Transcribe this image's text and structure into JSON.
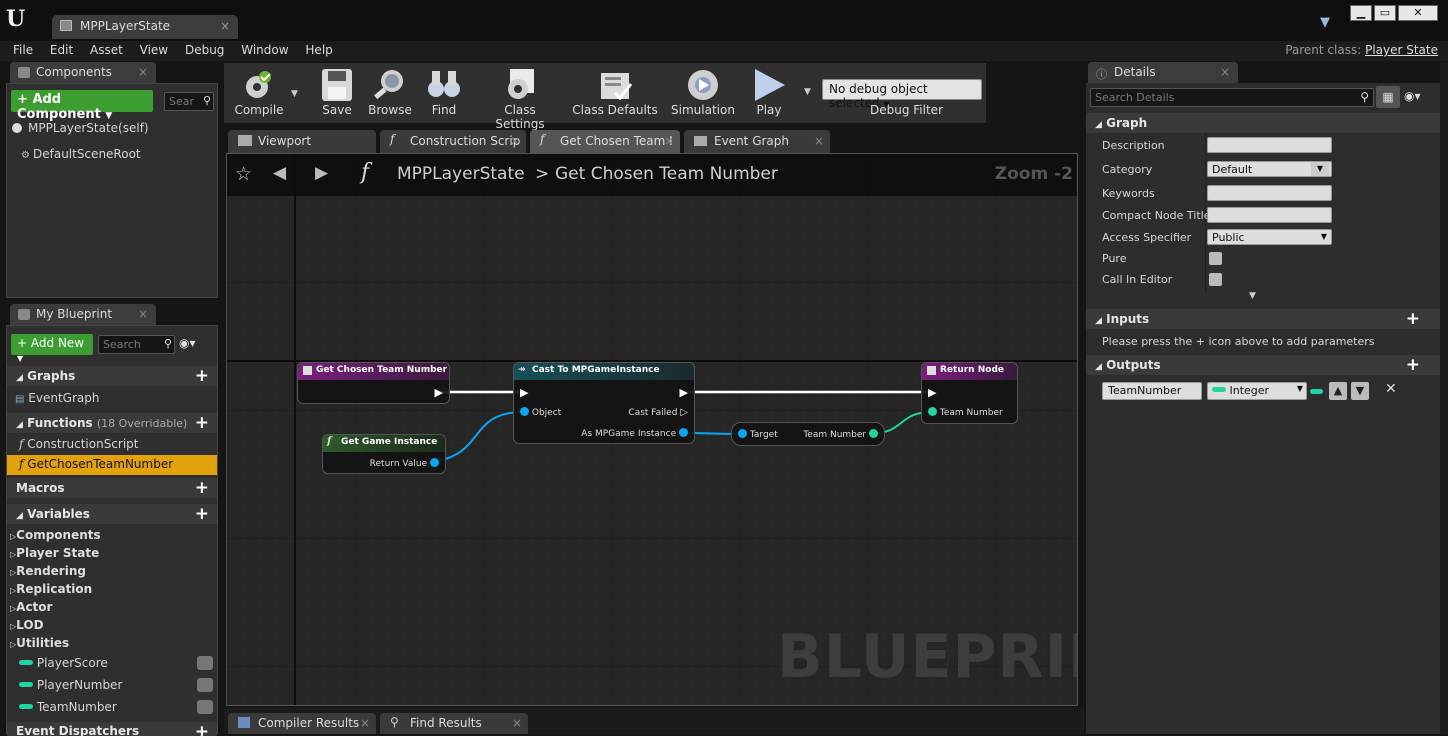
{
  "window": {
    "tab_title": "MPPLayerState",
    "tab_close": "×",
    "btn_min": "▁",
    "btn_max": "▭",
    "btn_close": "✕"
  },
  "menu": [
    "File",
    "Edit",
    "Asset",
    "View",
    "Debug",
    "Window",
    "Help"
  ],
  "parent_class": {
    "label": "Parent class:",
    "value": "Player State"
  },
  "components": {
    "tab": "Components",
    "close": "×",
    "add_label": "Add Component",
    "search_placeholder": "Sear",
    "items": [
      "MPPLayerState(self)",
      "DefaultSceneRoot"
    ]
  },
  "my_blueprint": {
    "tab": "My Blueprint",
    "close": "×",
    "add_label": "Add New",
    "search_placeholder": "Search",
    "graphs_head": "Graphs",
    "graphs": [
      "EventGraph"
    ],
    "functions_head": "Functions",
    "functions_note": "(18 Overridable)",
    "functions": [
      "ConstructionScript",
      "GetChosenTeamNumber"
    ],
    "macros_head": "Macros",
    "variables_head": "Variables",
    "var_categories": [
      "Components",
      "Player State",
      "Rendering",
      "Replication",
      "Actor",
      "LOD",
      "Utilities"
    ],
    "variables": [
      "PlayerScore",
      "PlayerNumber",
      "TeamNumber"
    ],
    "dispatchers_head": "Event Dispatchers"
  },
  "toolbar": {
    "compile": "Compile",
    "save": "Save",
    "browse": "Browse",
    "find": "Find",
    "class_settings": "Class Settings",
    "class_defaults": "Class Defaults",
    "simulation": "Simulation",
    "play": "Play",
    "debug_select": "No debug object selected",
    "debug_filter": "Debug Filter"
  },
  "graph_tabs": [
    "Viewport",
    "Construction Scrip",
    "Get Chosen Team I",
    "Event Graph"
  ],
  "breadcrumb": {
    "root": "MPPLayerState",
    "sep": ">",
    "current": "Get Chosen Team Number",
    "zoom": "Zoom -2"
  },
  "watermark": "BLUEPRINT",
  "nodes": {
    "entry": {
      "title": "Get Chosen Team Number"
    },
    "cast": {
      "title": "Cast To MPGameInstance",
      "in_object": "Object",
      "out_failed": "Cast Failed",
      "out_as": "As MPGame Instance"
    },
    "getgi": {
      "title": "Get Game Instance",
      "out": "Return Value"
    },
    "getter": {
      "in": "Target",
      "out": "Team Number"
    },
    "ret": {
      "title": "Return Node",
      "in": "Team Number"
    }
  },
  "bottom_tabs": [
    "Compiler Results",
    "Find Results"
  ],
  "details": {
    "tab": "Details",
    "close": "×",
    "search_placeholder": "Search Details",
    "graph_head": "Graph",
    "rows": [
      "Description",
      "Category",
      "Keywords",
      "Compact Node Title",
      "Access Specifier",
      "Pure",
      "Call In Editor"
    ],
    "category_value": "Default",
    "access_value": "Public",
    "inputs_head": "Inputs",
    "inputs_note": "Please press the + icon above to add parameters",
    "outputs_head": "Outputs",
    "output_name": "TeamNumber",
    "output_type": "Integer"
  },
  "colors": {
    "accent_green": "#3c9e30",
    "selected": "#e3a20a",
    "integer_pin": "#1fd6a0",
    "object_pin": "#0ba6f0",
    "func_head": "#7a1f7f",
    "cast_head": "#16505a",
    "pure_head": "#2f5a2a"
  }
}
